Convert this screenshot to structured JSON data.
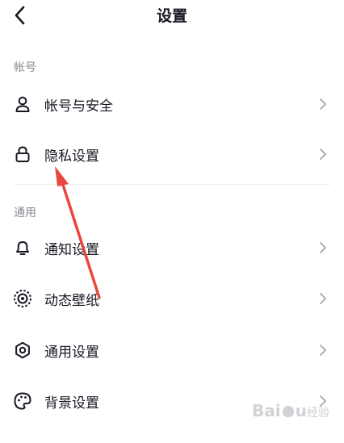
{
  "header": {
    "title": "设置"
  },
  "sections": [
    {
      "label": "帐号",
      "items": [
        {
          "label": "帐号与安全",
          "icon": "person-icon"
        },
        {
          "label": "隐私设置",
          "icon": "lock-icon"
        }
      ]
    },
    {
      "label": "通用",
      "items": [
        {
          "label": "通知设置",
          "icon": "bell-icon"
        },
        {
          "label": "动态壁纸",
          "icon": "wallpaper-icon"
        },
        {
          "label": "通用设置",
          "icon": "gear-icon"
        },
        {
          "label": "背景设置",
          "icon": "palette-icon"
        }
      ]
    }
  ],
  "annotation": {
    "type": "arrow",
    "color": "#e8473f",
    "points_to": "隐私设置"
  },
  "watermark": {
    "brand": "Bai",
    "text": "经验"
  }
}
